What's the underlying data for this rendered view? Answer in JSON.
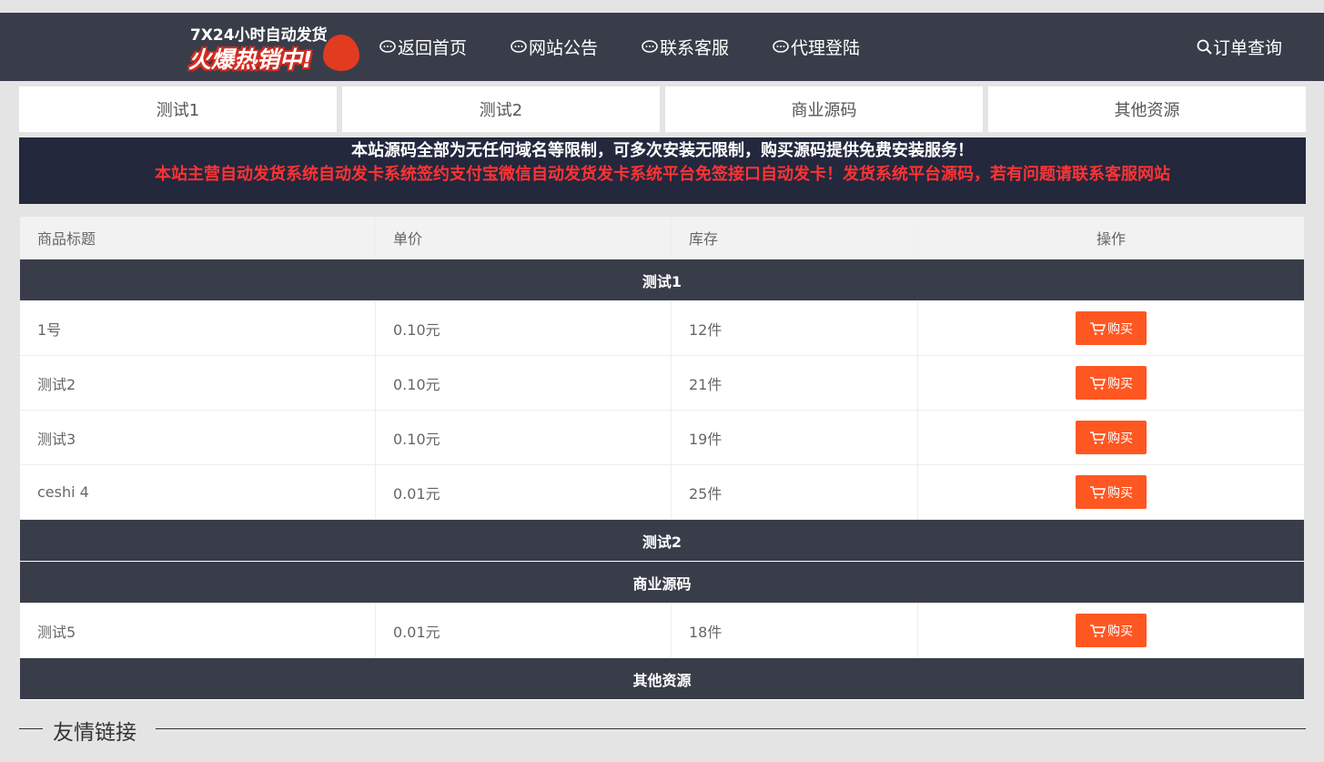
{
  "header": {
    "logo_line1": "7X24小时自动发货",
    "logo_line2": "火爆热销中!",
    "nav": [
      {
        "label": "返回首页"
      },
      {
        "label": "网站公告"
      },
      {
        "label": "联系客服"
      },
      {
        "label": "代理登陆"
      }
    ],
    "order_query": "订单查询"
  },
  "tabs": [
    "测试1",
    "测试2",
    "商业源码",
    "其他资源"
  ],
  "notice": {
    "line1": "本站源码全部为无任何域名等限制，可多次安装无限制，购买源码提供免费安装服务！",
    "line2": "本站主营自动发货系统自动发卡系统签约支付宝微信自动发货发卡系统平台免签接口自动发卡！发货系统平台源码，若有问题请联系客服网站"
  },
  "table": {
    "headers": [
      "商品标题",
      "单价",
      "库存",
      "操作"
    ],
    "buy_label": "购买",
    "categories": [
      {
        "name": "测试1",
        "items": [
          {
            "title": "1号",
            "price": "0.10元",
            "stock": "12件"
          },
          {
            "title": "测试2",
            "price": "0.10元",
            "stock": "21件"
          },
          {
            "title": "测试3",
            "price": "0.10元",
            "stock": "19件"
          },
          {
            "title": "ceshi 4",
            "price": "0.01元",
            "stock": "25件"
          }
        ]
      },
      {
        "name": "测试2",
        "items": []
      },
      {
        "name": "商业源码",
        "items": [
          {
            "title": "测试5",
            "price": "0.01元",
            "stock": "18件"
          }
        ]
      },
      {
        "name": "其他资源",
        "items": []
      }
    ]
  },
  "links": {
    "title": "友情链接"
  },
  "colors": {
    "header_bg": "#393d49",
    "notice_bg": "#23283d",
    "notice_red": "#ff3333",
    "buy_bg": "#ff5722"
  }
}
